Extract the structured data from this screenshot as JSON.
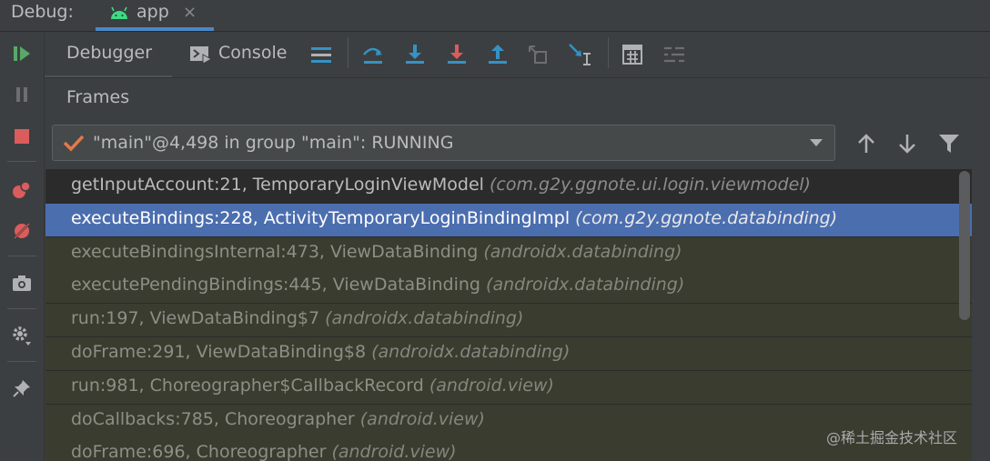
{
  "top_tabs": {
    "debug_label": "Debug:",
    "app_tab_label": "app",
    "close_symbol": "×"
  },
  "left_toolbar": {
    "icons": [
      "resume-program-icon",
      "pause-program-icon",
      "stop-icon",
      "view-breakpoints-icon",
      "mute-breakpoints-icon",
      "camera-icon",
      "settings-icon",
      "pin-icon"
    ]
  },
  "toolbar": {
    "debugger_tab": "Debugger",
    "console_tab": "Console"
  },
  "frames": {
    "header": "Frames",
    "thread": "\"main\"@4,498 in group \"main\": RUNNING",
    "rows": [
      {
        "method": "getInputAccount:21, TemporaryLoginViewModel",
        "package": "(com.g2y.ggnote.ui.login.viewmodel)",
        "state": "normal"
      },
      {
        "method": "executeBindings:228, ActivityTemporaryLoginBindingImpl",
        "package": "(com.g2y.ggnote.databinding)",
        "state": "selected"
      },
      {
        "method": "executeBindingsInternal:473, ViewDataBinding",
        "package": "(androidx.databinding)",
        "state": "lib"
      },
      {
        "method": "executePendingBindings:445, ViewDataBinding",
        "package": "(androidx.databinding)",
        "state": "lib"
      },
      {
        "method": "run:197, ViewDataBinding$7",
        "package": "(androidx.databinding)",
        "state": "lib"
      },
      {
        "method": "doFrame:291, ViewDataBinding$8",
        "package": "(androidx.databinding)",
        "state": "lib"
      },
      {
        "method": "run:981, Choreographer$CallbackRecord",
        "package": "(android.view)",
        "state": "lib"
      },
      {
        "method": "doCallbacks:785, Choreographer",
        "package": "(android.view)",
        "state": "lib"
      },
      {
        "method": "doFrame:696, Choreographer",
        "package": "(android.view)",
        "state": "lib"
      }
    ]
  },
  "watermark": "@稀土掘金技术社区",
  "colors": {
    "selection": "#4b6eaf",
    "resume_green": "#59a869",
    "stop_red": "#db5c5c",
    "step_blue": "#3592c4",
    "check_orange": "#e3794a"
  }
}
